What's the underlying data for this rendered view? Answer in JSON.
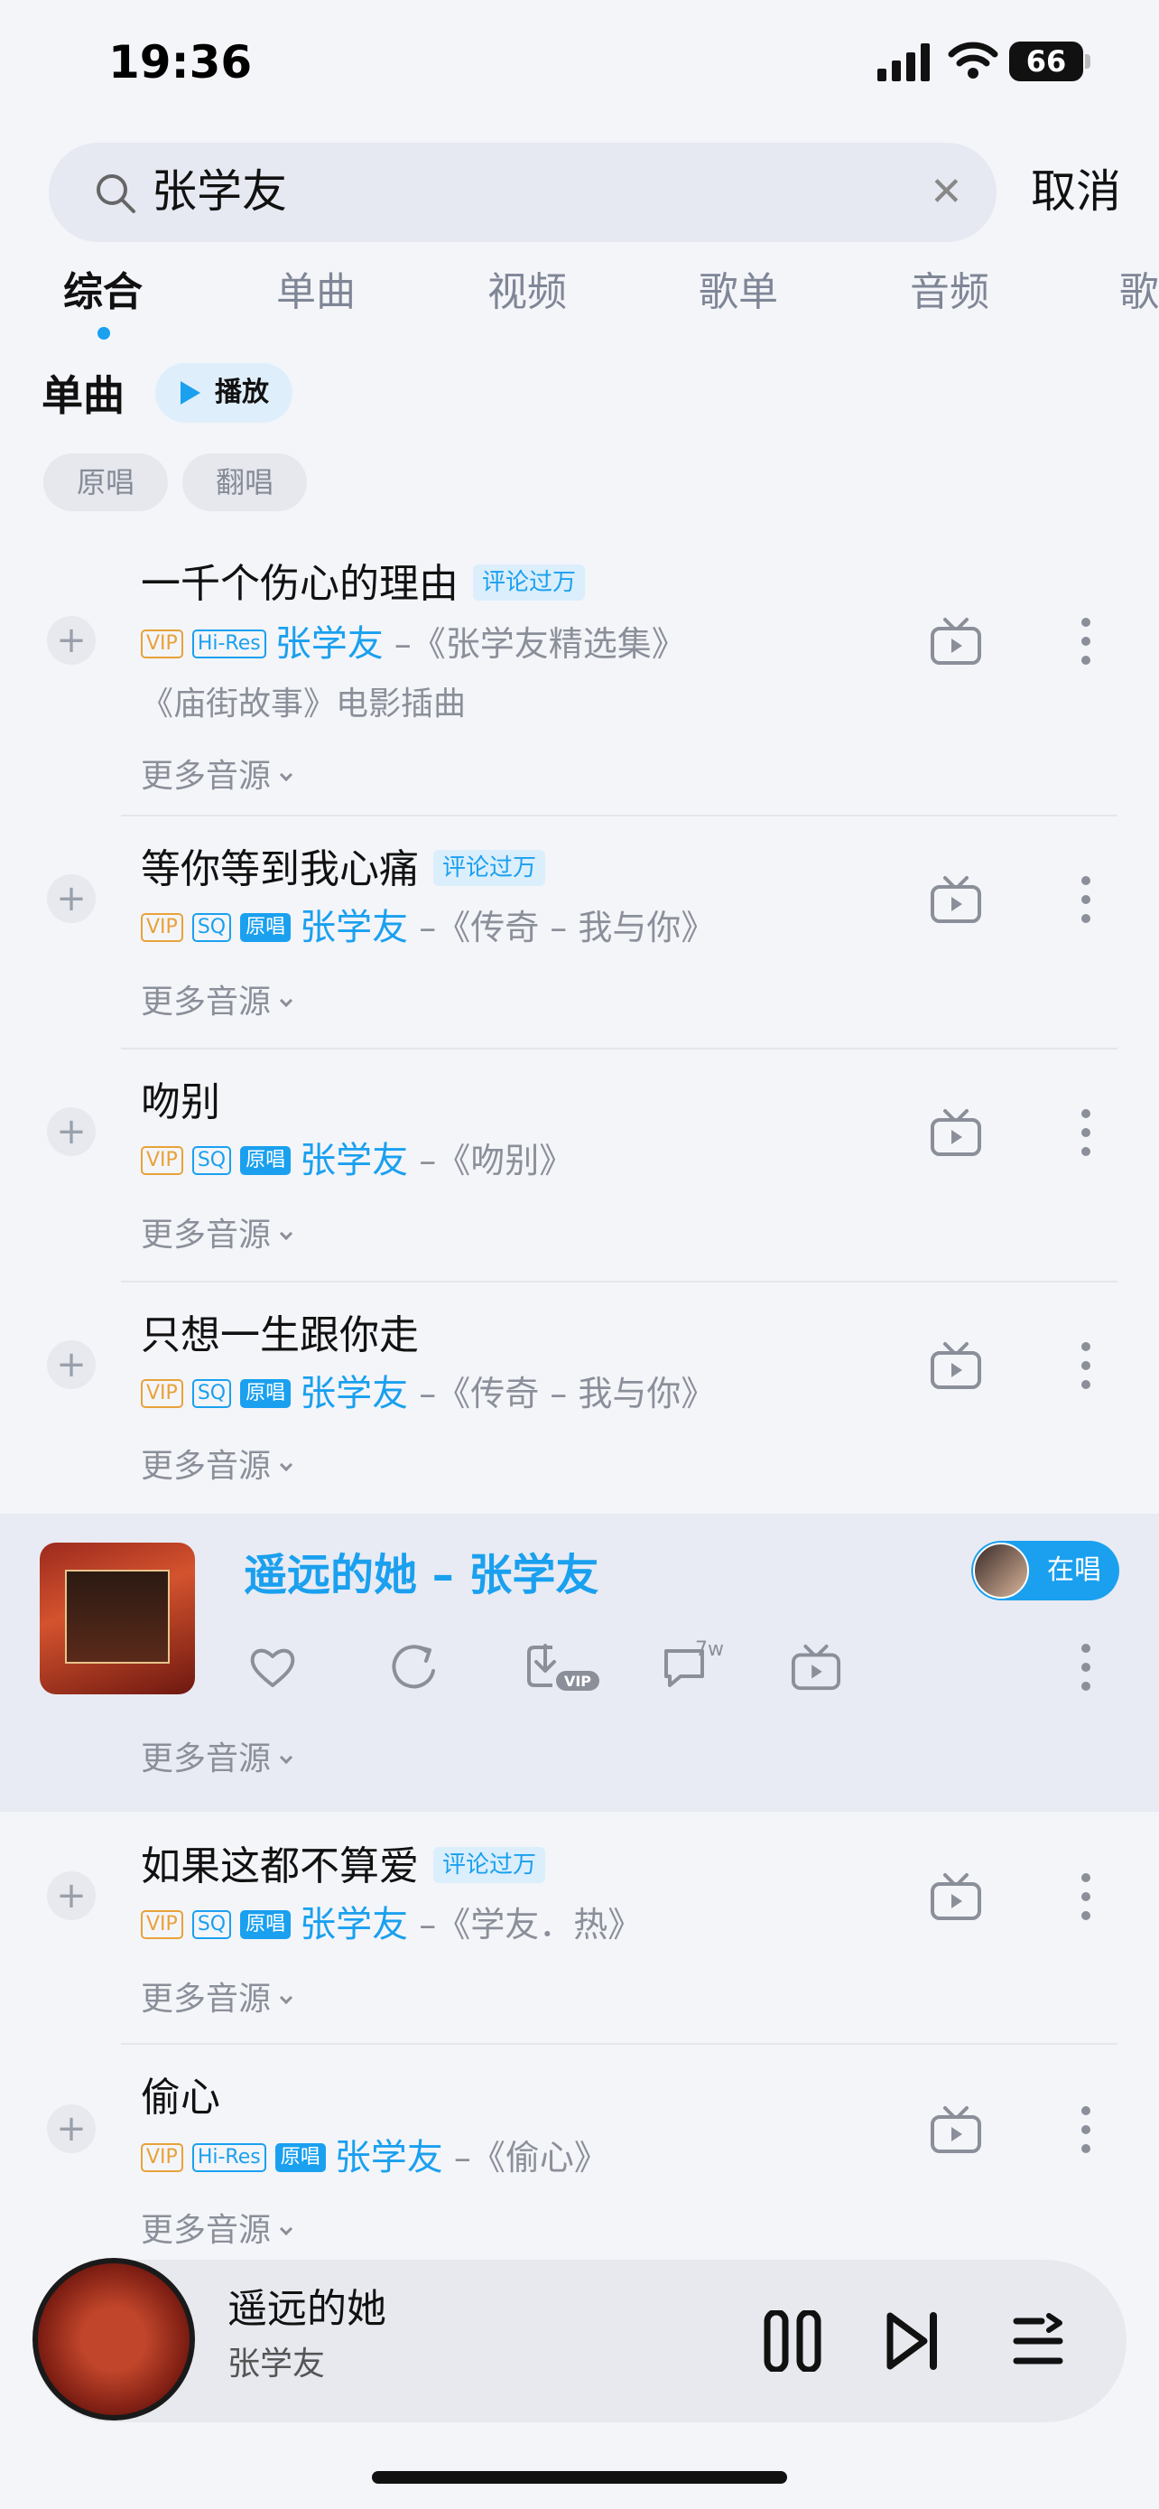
{
  "status": {
    "time": "19:36",
    "battery": "66"
  },
  "search": {
    "query": "张学友",
    "cancel": "取消"
  },
  "tabs": [
    {
      "label": "综合"
    },
    {
      "label": "单曲"
    },
    {
      "label": "视频"
    },
    {
      "label": "歌单"
    },
    {
      "label": "音频"
    },
    {
      "label": "歌"
    }
  ],
  "section": {
    "title": "单曲",
    "play_all": "播放",
    "filters": [
      "原唱",
      "翻唱"
    ]
  },
  "tags": {
    "vip": "VIP",
    "sq": "SQ",
    "hires": "Hi-Res",
    "orig": "原唱",
    "comments_10k": "评论过万",
    "more_sources": "更多音源"
  },
  "songs": [
    {
      "title": "一千个伤心的理由",
      "artist": "张学友",
      "album": "–《张学友精选集》",
      "desc": "《庙街故事》电影插曲"
    },
    {
      "title": "等你等到我心痛",
      "artist": "张学友",
      "album": "–《传奇 – 我与你》"
    },
    {
      "title": "吻别",
      "artist": "张学友",
      "album": "–《吻别》"
    },
    {
      "title": "只想一生跟你走",
      "artist": "张学友",
      "album": "–《传奇 – 我与你》"
    },
    {
      "title": "如果这都不算爱",
      "artist": "张学友",
      "album": "–《学友．热》"
    },
    {
      "title": "偷心",
      "artist": "张学友",
      "album": "–《偷心》"
    }
  ],
  "now_playing_row": {
    "title": "遥远的她 – 张学友",
    "singing": "在唱",
    "comment_count": "7w",
    "download_badge": "VIP"
  },
  "mini_player": {
    "title": "遥远的她",
    "artist": "张学友"
  },
  "colors": {
    "accent": "#1aa0ef",
    "vip": "#e8a23a",
    "background": "#f4f5f9"
  }
}
